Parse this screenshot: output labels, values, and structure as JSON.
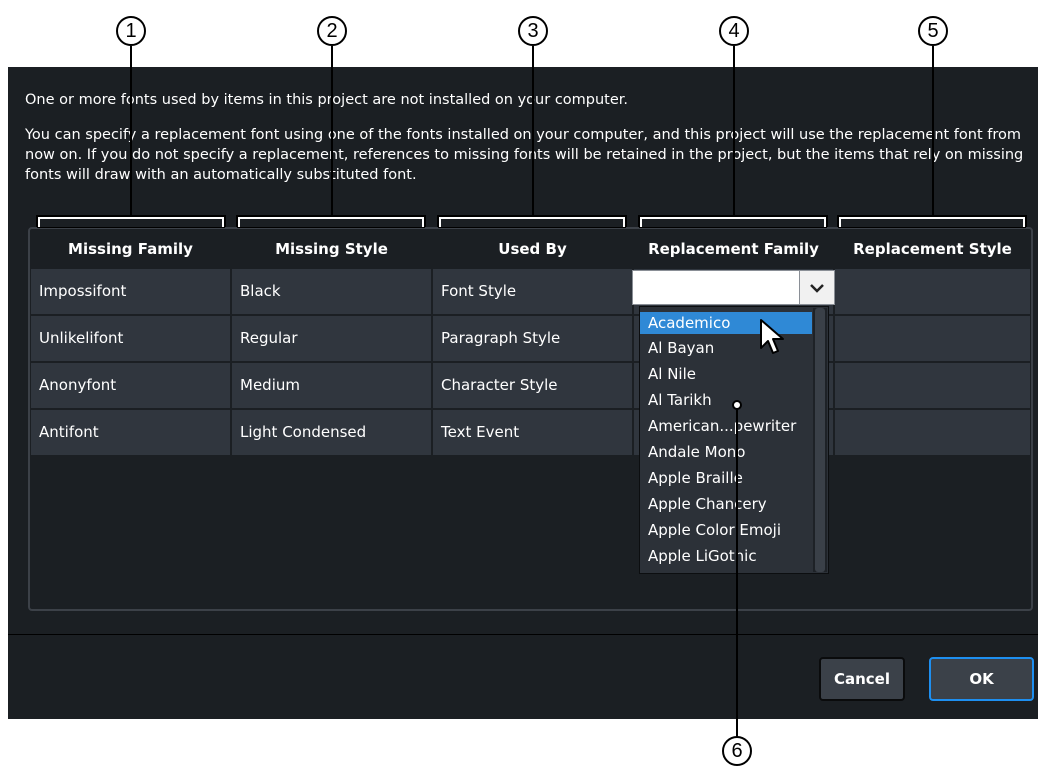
{
  "callouts": [
    {
      "num": "1"
    },
    {
      "num": "2"
    },
    {
      "num": "3"
    },
    {
      "num": "4"
    },
    {
      "num": "5"
    },
    {
      "num": "6"
    }
  ],
  "dialog": {
    "line1": "One or more fonts used by items in this project are not installed on your computer.",
    "line2": "You can specify a replacement font using one of the fonts installed on your computer, and this project will use the replacement font from now on. If you do not specify a replacement, references to missing fonts will be retained in the project, but the items that rely on missing fonts will draw with an automatically substituted font."
  },
  "table": {
    "headers": [
      "Missing Family",
      "Missing Style",
      "Used By",
      "Replacement Family",
      "Replacement Style"
    ],
    "rows": [
      {
        "family": "Impossifont",
        "style": "Black",
        "used_by": "Font Style"
      },
      {
        "family": "Unlikelifont",
        "style": "Regular",
        "used_by": "Paragraph Style"
      },
      {
        "family": "Anonyfont",
        "style": "Medium",
        "used_by": "Character Style"
      },
      {
        "family": "Antifont",
        "style": "Light Condensed",
        "used_by": "Text Event"
      }
    ]
  },
  "dropdown": {
    "selected": "Academico",
    "items": [
      "Academico",
      "Al Bayan",
      "Al Nile",
      "Al Tarikh",
      "American...pewriter",
      "Andale Mono",
      "Apple Braille",
      "Apple Chancery",
      "Apple Color Emoji",
      "Apple LiGothic"
    ]
  },
  "buttons": {
    "cancel": "Cancel",
    "ok": "OK"
  },
  "colors": {
    "accent": "#1e8ff0",
    "selection": "#2f89d6",
    "dialog_bg": "#1b1f23",
    "cell_bg": "#30363e"
  },
  "icons": {
    "combo": "chevron-down-icon",
    "pointer": "mouse-cursor-icon"
  }
}
